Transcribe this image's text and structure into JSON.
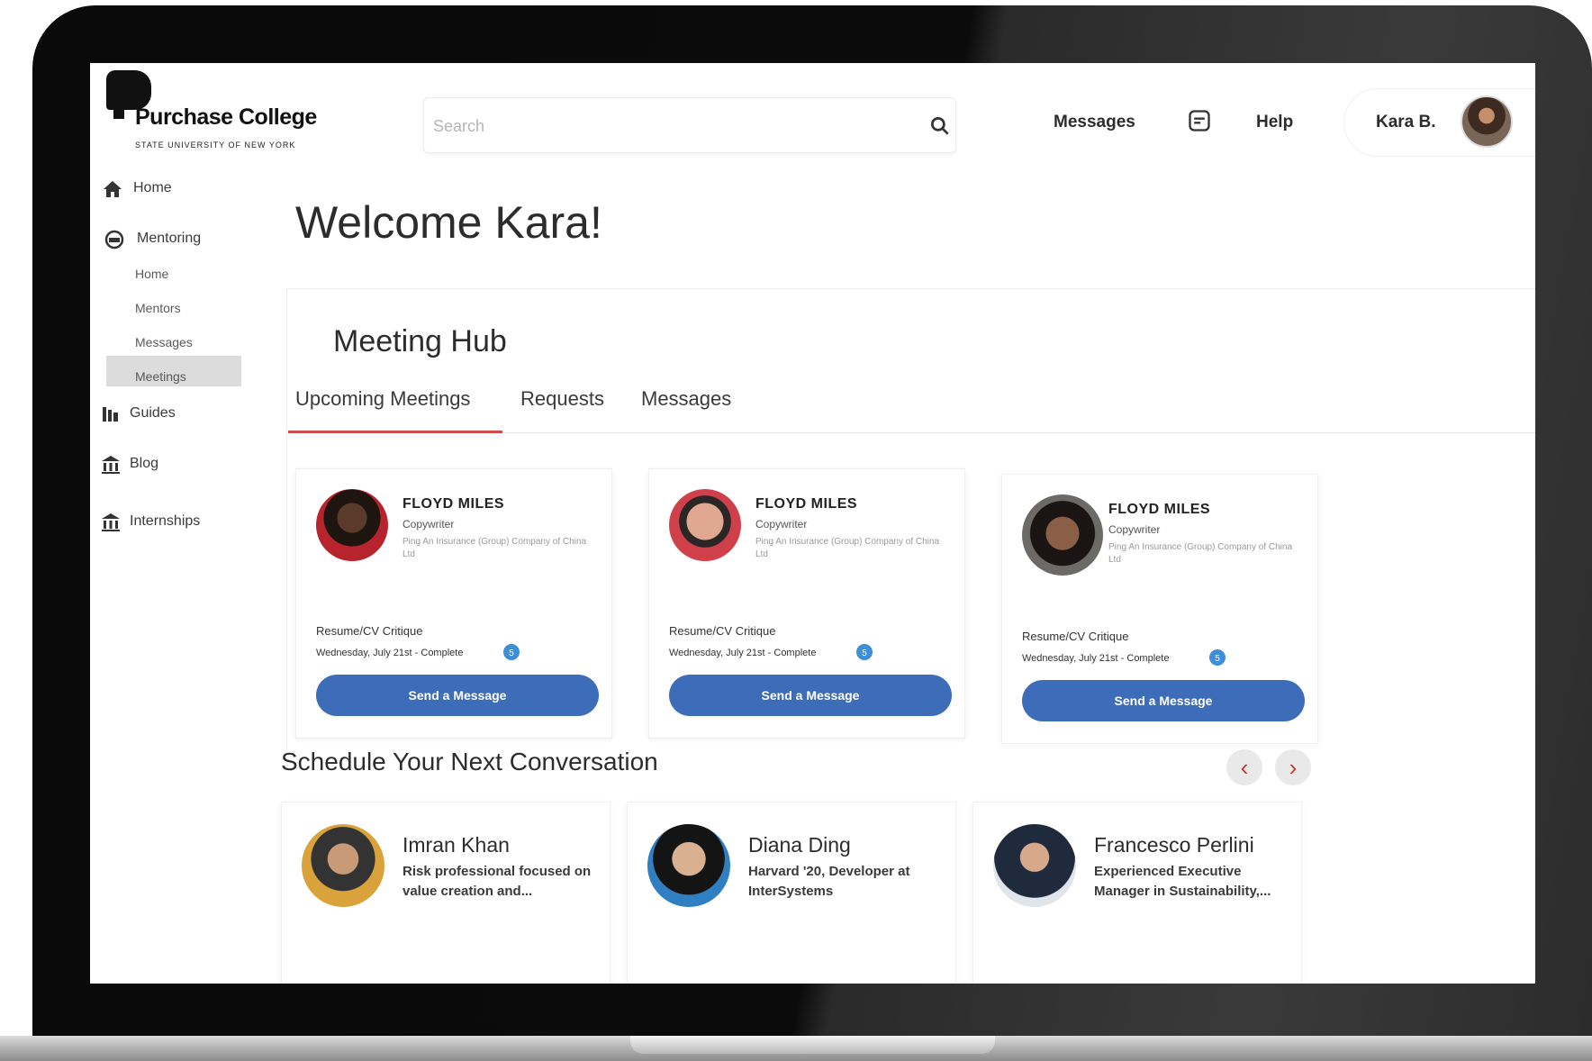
{
  "brand": {
    "name": "Purchase College",
    "subtitle": "STATE UNIVERSITY OF NEW YORK"
  },
  "header": {
    "search_placeholder": "Search",
    "messages_label": "Messages",
    "help_label": "Help",
    "user_name": "Kara B."
  },
  "sidebar": {
    "items": [
      {
        "label": "Home",
        "icon": "home-icon"
      },
      {
        "label": "Mentoring",
        "icon": "mentoring-icon"
      },
      {
        "label": "Guides",
        "icon": "guides-icon"
      },
      {
        "label": "Blog",
        "icon": "blog-icon"
      },
      {
        "label": "Internships",
        "icon": "internships-icon"
      }
    ],
    "mentoring_sub": [
      "Home",
      "Mentors",
      "Messages",
      "Meetings"
    ],
    "active_sub": "Mentors"
  },
  "main": {
    "welcome": "Welcome Kara!",
    "hub_title": "Meeting Hub",
    "tabs": [
      "Upcoming Meetings",
      "Requests",
      "Messages"
    ],
    "active_tab": "Upcoming Meetings"
  },
  "meetings": [
    {
      "name": "FLOYD MILES",
      "role": "Copywriter",
      "company": "Ping An Insurance (Group) Company of China Ltd",
      "topic": "Resume/CV Critique",
      "when": "Wednesday, July 21st  -  Complete",
      "badge": "5",
      "button": "Send a Message"
    },
    {
      "name": "FLOYD MILES",
      "role": "Copywriter",
      "company": "Ping An Insurance (Group) Company of China Ltd",
      "topic": "Resume/CV Critique",
      "when": "Wednesday, July 21st  -  Complete",
      "badge": "5",
      "button": "Send a Message"
    },
    {
      "name": "FLOYD MILES",
      "role": "Copywriter",
      "company": "Ping An Insurance (Group) Company of China Ltd",
      "topic": "Resume/CV Critique",
      "when": "Wednesday, July 21st  -  Complete",
      "badge": "5",
      "button": "Send a Message"
    }
  ],
  "schedule": {
    "title": "Schedule Your Next Conversation",
    "prev": "‹",
    "next": "›",
    "mentors": [
      {
        "name": "Imran Khan",
        "desc": "Risk professional focused on value creation and..."
      },
      {
        "name": "Diana Ding",
        "desc": "Harvard '20, Developer at InterSystems"
      },
      {
        "name": "Francesco Perlini",
        "desc": "Experienced Executive Manager in Sustainability,..."
      }
    ]
  },
  "colors": {
    "accent_blue": "#3d6db8",
    "tab_underline": "#d24a4a",
    "badge_blue": "#3f8ed8"
  }
}
